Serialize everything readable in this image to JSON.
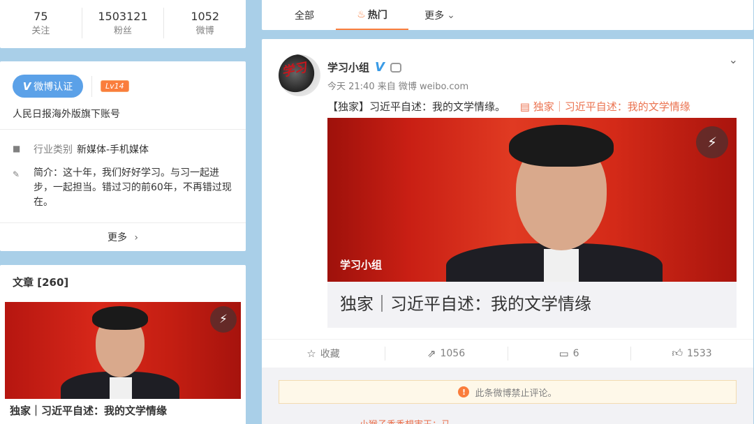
{
  "stats": [
    {
      "num": "75",
      "label": "关注"
    },
    {
      "num": "1503121",
      "label": "粉丝"
    },
    {
      "num": "1052",
      "label": "微博"
    }
  ],
  "profile": {
    "verify_label": "微博认证",
    "level": "Lv14",
    "description": "人民日报海外版旗下账号",
    "industry_key": "行业类别",
    "industry_value": "新媒体-手机媒体",
    "intro": "简介：这十年，我们好好学习。与习一起进步，一起担当。错过习的前60年，不再错过现在。",
    "more": "更多"
  },
  "articles": {
    "heading": "文章 [260]",
    "caption": "独家｜习近平自述：我的文学情缘"
  },
  "tabs": [
    {
      "label": "全部"
    },
    {
      "label": "热门"
    },
    {
      "label": "更多"
    }
  ],
  "post": {
    "username": "学习小组",
    "time": "今天 21:40",
    "source": "来自 微博 weibo.com",
    "text": "【独家】习近平自述：我的文学情缘。",
    "link_text": "独家｜习近平自述：我的文学情缘",
    "image_watermark": "学习小组",
    "image_title": "独家｜习近平自述：我的文学情缘",
    "avatar_text": "学习",
    "actions": {
      "favorite": "收藏",
      "repost": "1056",
      "comment": "6",
      "like": "1533"
    },
    "notice": "此条微博禁止评论。",
    "cutoff_comment": "小猴子香香想害王：马"
  },
  "colors": {
    "accent": "#fa7d3c",
    "verify_blue": "#5ba1e8",
    "link": "#eb7350",
    "background": "#a9cfe8"
  },
  "icons": [
    "lightning-icon",
    "chevron-down-icon",
    "chevron-right-icon",
    "star-icon",
    "repost-icon",
    "comment-icon",
    "like-icon",
    "warning-icon",
    "briefcase-icon",
    "edit-icon",
    "flame-icon",
    "robot-icon",
    "verified-icon"
  ]
}
